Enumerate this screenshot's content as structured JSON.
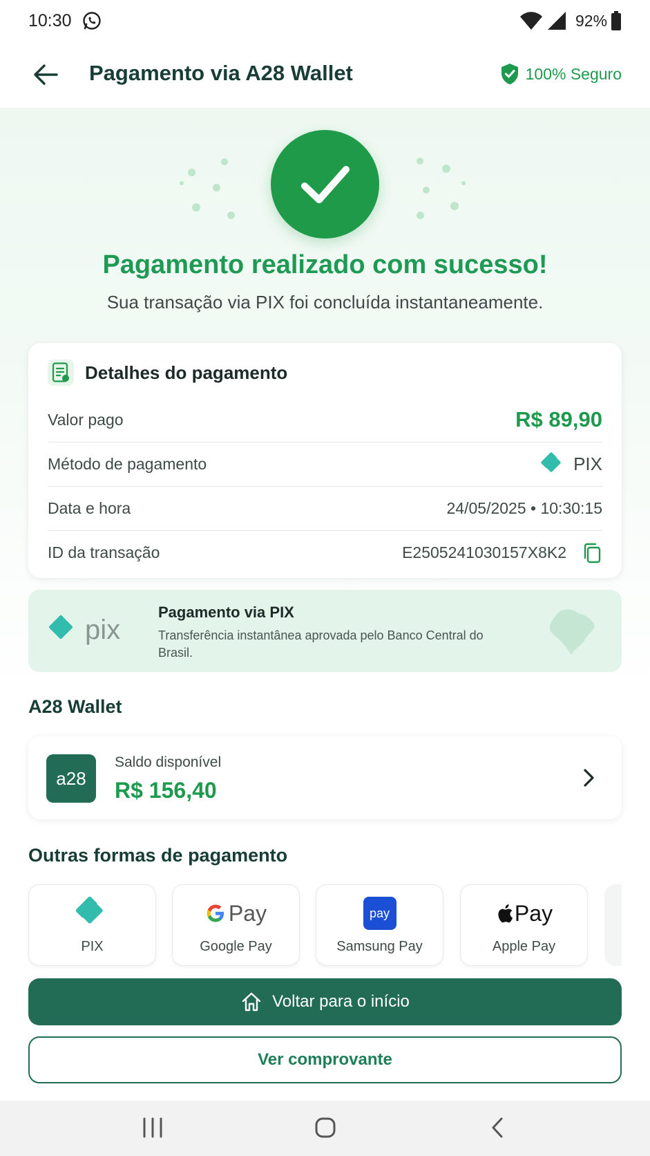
{
  "status_bar": {
    "time": "10:30",
    "battery": "92%"
  },
  "header": {
    "title": "Pagamento via A28 Wallet",
    "secure_label": "100% Seguro"
  },
  "success": {
    "title": "Pagamento realizado com sucesso!",
    "subtitle": "Sua transação via PIX foi concluída instantaneamente."
  },
  "details": {
    "title": "Detalhes do pagamento",
    "rows": [
      {
        "label": "Valor pago",
        "value": "R$ 89,90"
      },
      {
        "label": "Método de pagamento",
        "value": "PIX"
      },
      {
        "label": "Data e hora",
        "value": "24/05/2025 • 10:30:15"
      },
      {
        "label": "ID da transação",
        "value": "E2505241030157X8K2"
      }
    ]
  },
  "pix_banner": {
    "logo_text": "pix",
    "title": "Pagamento via PIX",
    "text": "Transferência instantânea aprovada pelo Banco Central do Brasil."
  },
  "wallet": {
    "section_title": "A28 Wallet",
    "logo_text": "a28",
    "balance_label": "Saldo disponível",
    "balance": "R$ 156,40"
  },
  "other_methods": {
    "section_title": "Outras formas de pagamento",
    "items": [
      {
        "label": "PIX"
      },
      {
        "label": "Google Pay",
        "logo_text": "Pay"
      },
      {
        "label": "Samsung Pay",
        "logo_text": "pay"
      },
      {
        "label": "Apple Pay",
        "logo_text": "Pay"
      }
    ]
  },
  "actions": {
    "primary": "Voltar para o início",
    "secondary": "Ver comprovante"
  },
  "colors": {
    "brand_dark": "#226b55",
    "success_green": "#1f9a48",
    "money_green": "#1e9a4e",
    "pix_teal": "#32bcad",
    "samsung_blue": "#1a4fd6"
  },
  "icons": [
    "whatsapp-icon",
    "wifi-icon",
    "signal-icon",
    "battery-icon",
    "back-arrow-icon",
    "shield-check-icon",
    "check-icon",
    "document-icon",
    "pix-icon",
    "copy-icon",
    "brazil-map-icon",
    "chevron-right-icon",
    "google-g-icon",
    "apple-icon",
    "home-icon",
    "nav-recent-icon",
    "nav-home-icon",
    "nav-back-icon"
  ]
}
